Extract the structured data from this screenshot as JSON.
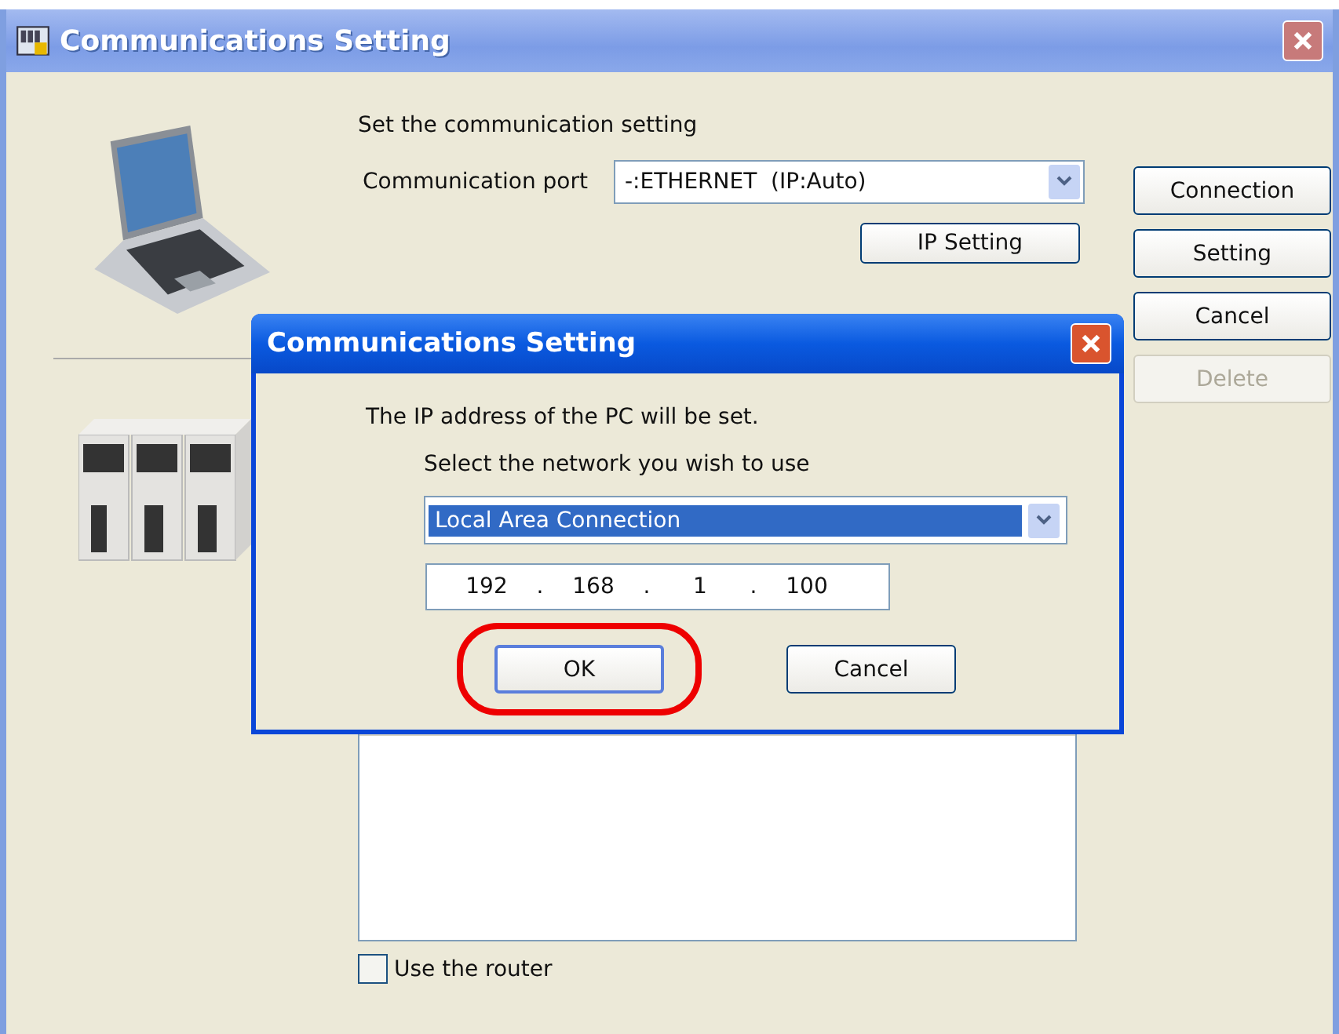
{
  "window": {
    "title": "Communications Setting"
  },
  "main": {
    "heading": "Set the communication setting",
    "port_label": "Communication port",
    "port_value": "-:ETHERNET  (IP:Auto)",
    "ip_setting_button": "IP Setting",
    "buttons": [
      {
        "label": "Connection",
        "disabled": false
      },
      {
        "label": "Setting",
        "disabled": false
      },
      {
        "label": "Cancel",
        "disabled": false
      },
      {
        "label": "Delete",
        "disabled": true
      }
    ],
    "router_checkbox": {
      "label": "Use the router",
      "checked": false
    }
  },
  "dialog": {
    "title": "Communications Setting",
    "message": "The IP address of the PC will be set.",
    "network_label": "Select the network you wish to use",
    "network": {
      "value": "Local Area Connection",
      "selected": true
    },
    "ip_address": [
      "192",
      ".",
      "168",
      ".",
      "1",
      ".",
      "100"
    ],
    "buttons": [
      {
        "label": "OK",
        "highlighted": true
      },
      {
        "label": "Cancel",
        "highlighted": false
      }
    ]
  }
}
